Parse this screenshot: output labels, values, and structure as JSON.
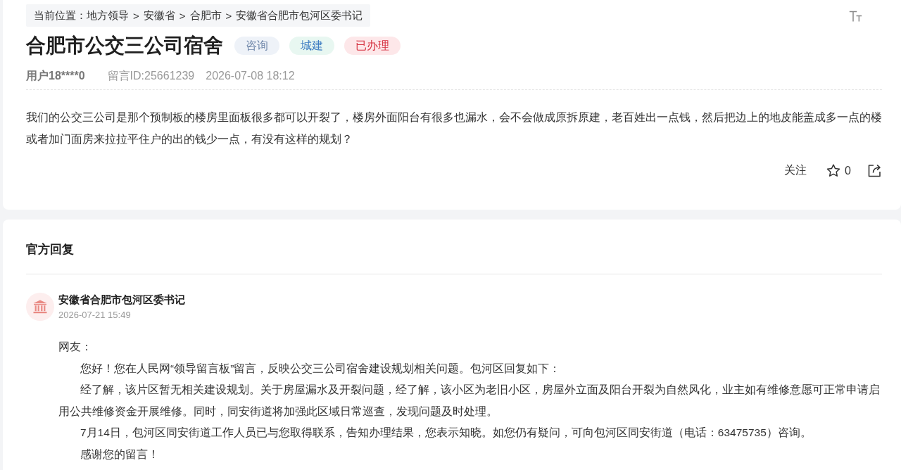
{
  "breadcrumb": [
    {
      "kind": "label",
      "text": "当前位置："
    },
    {
      "kind": "link",
      "text": "地方领导"
    },
    {
      "kind": "separator",
      "text": ">"
    },
    {
      "kind": "link",
      "text": "安徽省"
    },
    {
      "kind": "separator",
      "text": ">"
    },
    {
      "kind": "link",
      "text": "合肥市"
    },
    {
      "kind": "separator",
      "text": ">"
    },
    {
      "kind": "link",
      "text": "安徽省合肥市包河区委书记"
    }
  ],
  "title": "合肥市公交三公司宿舍",
  "tags": [
    {
      "kind": "category",
      "text": "咨询"
    },
    {
      "kind": "field",
      "text": "城建"
    },
    {
      "kind": "status",
      "text": "已办理"
    }
  ],
  "meta": {
    "user": "用户18****0",
    "message_id": "留言ID:25661239",
    "time": "2026-07-08 18:12"
  },
  "message": "我们的公交三公司是那个预制板的楼房里面板很多都可以开裂了，楼房外面阳台有很多也漏水，会不会做成原拆原建，老百姓出一点钱，然后把边上的地皮能盖成多一点的楼或者加门面房来拉拉平住户的出的钱少一点，有没有这样的规划？",
  "actions": {
    "follow": "关注",
    "likes": "0"
  },
  "reply": {
    "heading": "官方回复",
    "author": "安徽省合肥市包河区委书记",
    "time": "2026-07-21 15:49",
    "salutation": "网友：",
    "paragraphs": [
      "您好！您在人民网“领导留言板”留言，反映公交三公司宿舍建设规划相关问题。包河区回复如下：",
      "经了解，该片区暂无相关建设规划。关于房屋漏水及开裂问题，经了解，该小区为老旧小区，房屋外立面及阳台开裂为自然风化，业主如有维修意愿可正常申请启用公共维修资金开展维修。同时，同安街道将加强此区域日常巡查，发现问题及时处理。",
      "7月14日，包河区同安街道工作人员已与您取得联系，告知办理结果，您表示知晓。如您仍有疑问，可向包河区同安街道（电话：63475735）咨询。",
      "感谢您的留言！"
    ]
  }
}
